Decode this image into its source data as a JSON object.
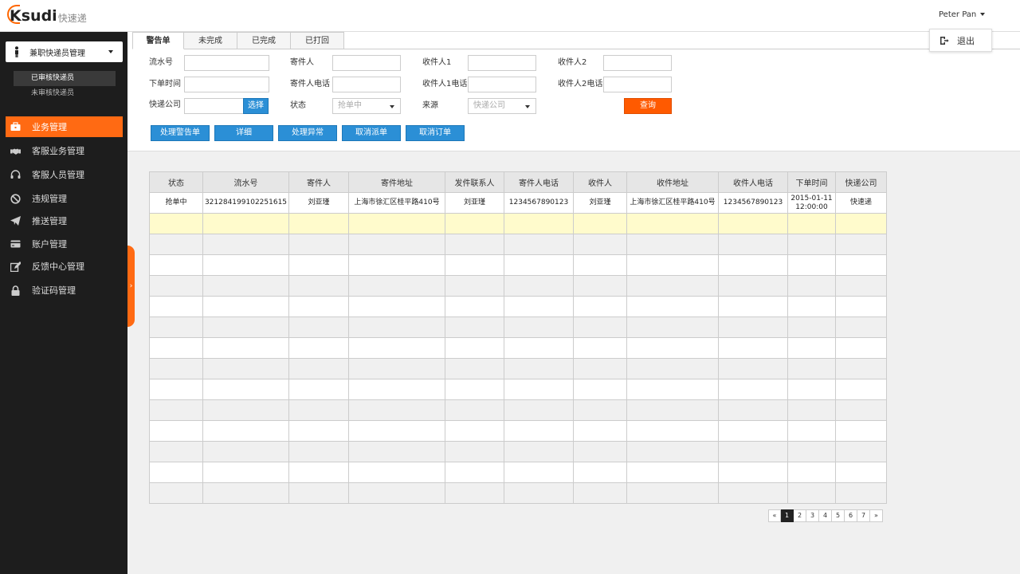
{
  "header": {
    "logo_text": "sudi",
    "logo_cn": "快速递",
    "user_name": "Peter Pan",
    "logout_label": "退出"
  },
  "sidebar": {
    "role_label": "兼职快递员管理",
    "sub_items": [
      {
        "label": "已审核快递员",
        "active": true
      },
      {
        "label": "未审核快递员",
        "active": false
      }
    ],
    "items": [
      {
        "label": "业务管理",
        "icon": "briefcase-icon",
        "active": true
      },
      {
        "label": "客服业务管理",
        "icon": "handshake-icon",
        "active": false
      },
      {
        "label": "客服人员管理",
        "icon": "headset-icon",
        "active": false
      },
      {
        "label": "违规管理",
        "icon": "ban-icon",
        "active": false
      },
      {
        "label": "推送管理",
        "icon": "send-icon",
        "active": false
      },
      {
        "label": "账户管理",
        "icon": "credit-card-icon",
        "active": false
      },
      {
        "label": "反馈中心管理",
        "icon": "edit-icon",
        "active": false
      },
      {
        "label": "验证码管理",
        "icon": "lock-icon",
        "active": false
      }
    ],
    "accent": "#ff6a13"
  },
  "tabs": [
    "警告单",
    "未完成",
    "已完成",
    "已打回"
  ],
  "filters": {
    "serial_label": "流水号",
    "sender_label": "寄件人",
    "receiver1_label": "收件人1",
    "receiver2_label": "收件人2",
    "order_time_label": "下单时间",
    "sender_phone_label": "寄件人电话",
    "receiver1_phone_label": "收件人1电话",
    "receiver2_phone_label": "收件人2电话",
    "company_label": "快递公司",
    "choose_button": "选择",
    "status_label": "状态",
    "status_value": "抢单中",
    "source_label": "来源",
    "source_placeholder": "快递公司",
    "query_button": "查询"
  },
  "actions": [
    "处理警告单",
    "详细",
    "处理异常",
    "取消派单",
    "取消订单"
  ],
  "table": {
    "columns": [
      "状态",
      "流水号",
      "寄件人",
      "寄件地址",
      "发件联系人",
      "寄件人电话",
      "收件人",
      "收件地址",
      "收件人电话",
      "下单时间",
      "快递公司"
    ],
    "rows": [
      [
        "抢单中",
        "321284199102251615",
        "刘亚瑾",
        "上海市徐汇区桂平路410号",
        "刘亚瑾",
        "1234567890123",
        "刘亚瑾",
        "上海市徐汇区桂平路410号",
        "1234567890123",
        "2015-01-11 12:00:00",
        "快速递"
      ]
    ],
    "empty_rows": 14
  },
  "pagination": {
    "prev": "«",
    "pages": [
      "1",
      "2",
      "3",
      "4",
      "5",
      "6",
      "7"
    ],
    "current": "1",
    "next": "»"
  },
  "colors": {
    "accent": "#ff6a13",
    "button_blue": "#2b8fd6",
    "highlight_row": "#fffbcc"
  }
}
